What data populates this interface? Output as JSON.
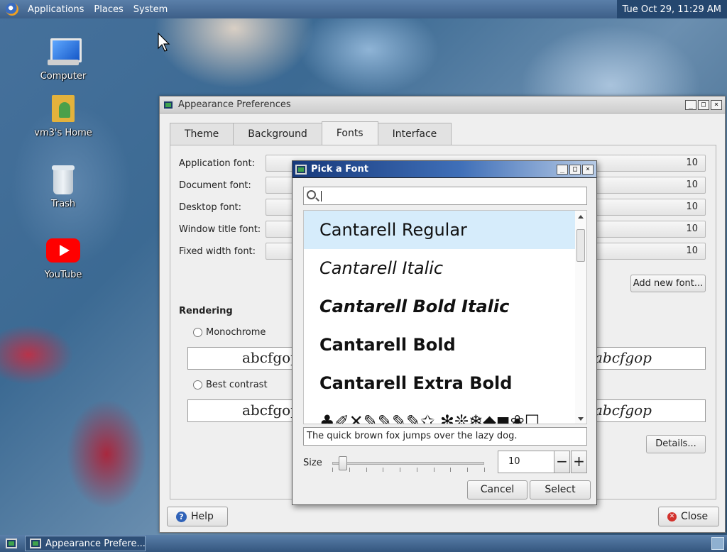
{
  "top_panel": {
    "menus": [
      "Applications",
      "Places",
      "System"
    ],
    "clock": "Tue Oct 29, 11:29 AM"
  },
  "desktop_icons": [
    {
      "label": "Computer",
      "icon": "computer-icon"
    },
    {
      "label": "vm3's Home",
      "icon": "home-folder-icon"
    },
    {
      "label": "Trash",
      "icon": "trash-icon"
    },
    {
      "label": "YouTube",
      "icon": "youtube-icon"
    }
  ],
  "taskbar": {
    "task_label": "Appearance Prefere..."
  },
  "appearance_window": {
    "title": "Appearance Preferences",
    "tabs": [
      "Theme",
      "Background",
      "Fonts",
      "Interface"
    ],
    "active_tab": "Fonts",
    "font_rows": [
      {
        "label": "Application font:",
        "size": "10"
      },
      {
        "label": "Document font:",
        "size": "10"
      },
      {
        "label": "Desktop font:",
        "size": "10"
      },
      {
        "label": "Window title font:",
        "size": "10"
      },
      {
        "label": "Fixed width font:",
        "size": "10"
      }
    ],
    "add_font_label": "Add new font...",
    "rendering_heading": "Rendering",
    "rendering_options": [
      {
        "label": "Monochrome",
        "sample_left": "abcfgop",
        "sample_right": "abcfgop"
      },
      {
        "label": "Best contrast",
        "sample_left": "abcfgop",
        "sample_right": "abcfgop"
      }
    ],
    "details_label": "Details...",
    "help_label": "Help",
    "close_label": "Close"
  },
  "font_dialog": {
    "title": "Pick a Font",
    "search_value": "",
    "fonts": [
      {
        "name": "Cantarell Regular",
        "style": "normal",
        "weight": "normal"
      },
      {
        "name": "Cantarell Italic",
        "style": "italic",
        "weight": "normal"
      },
      {
        "name": "Cantarell Bold Italic",
        "style": "italic",
        "weight": "bold"
      },
      {
        "name": "Cantarell Bold",
        "style": "normal",
        "weight": "bold"
      },
      {
        "name": "Cantarell Extra Bold",
        "style": "normal",
        "weight": "900"
      },
      {
        "name": "♣✐✕✎✎✎✎✩ ✻❊❄◆◼❀☐",
        "style": "normal",
        "weight": "normal"
      }
    ],
    "selected_index": 0,
    "preview_text": "The quick brown fox jumps over the lazy dog.",
    "size_label": "Size",
    "size_value": "10",
    "size_fraction": 0.04,
    "cancel_label": "Cancel",
    "select_label": "Select"
  }
}
